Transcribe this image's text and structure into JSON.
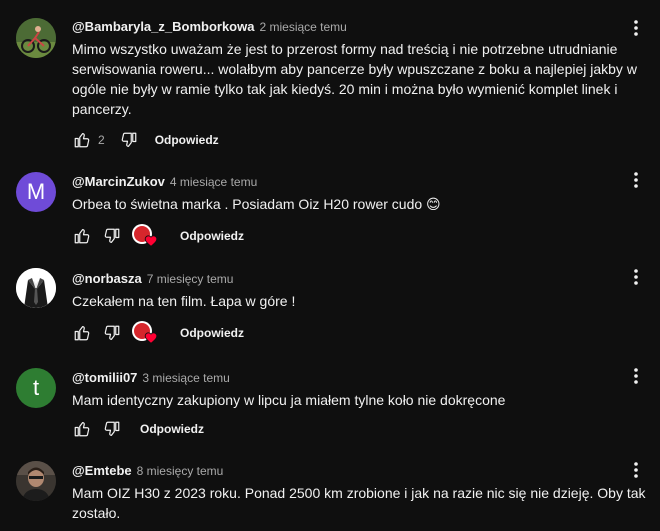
{
  "comments": [
    {
      "author": "@Bambaryla_z_Bomborkowa",
      "time": "2 miesiące temu",
      "text": "Mimo wszystko uważam że jest to przerost formy nad treścią i nie potrzebne utrudnianie serwisowania roweru... wolałbym aby pancerze były wpuszczane z boku a najlepiej jakby w ogóle nie były w ramie tylko tak jak kiedyś. 20 min i można było wymienić komplet linek i pancerzy.",
      "likes": "2",
      "reply_label": "Odpowiedz"
    },
    {
      "author": "@MarcinZukov",
      "time": "4 miesiące temu",
      "text": "Orbea to świetna marka . Posiadam Oiz H20 rower cudo 😊",
      "avatar_letter": "M",
      "avatar_color": "#6f4bd8",
      "reply_label": "Odpowiedz"
    },
    {
      "author": "@norbasza",
      "time": "7 miesięcy temu",
      "text": "Czekałem na ten film. Łapa w góre !",
      "reply_label": "Odpowiedz"
    },
    {
      "author": "@tomilii07",
      "time": "3 miesiące temu",
      "text": "Mam identyczny zakupiony w lipcu ja miałem tylne koło nie dokręcone",
      "avatar_letter": "t",
      "avatar_color": "#2e7d32",
      "reply_label": "Odpowiedz"
    },
    {
      "author": "@Emtebe",
      "time": "8 miesięcy temu",
      "text": "Mam OIZ H30 z 2023 roku. Ponad 2500 km zrobione i jak na razie nic się nie dzieję. Oby tak zostało."
    }
  ],
  "colors": {
    "background": "#0f0f0f",
    "text": "#f1f1f1",
    "secondary_text": "#aaaaaa",
    "heart": "#ff0033"
  }
}
